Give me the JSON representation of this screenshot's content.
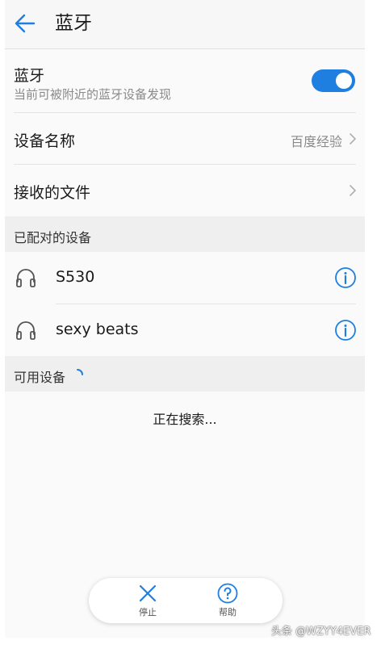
{
  "header": {
    "title": "蓝牙",
    "back_icon": "back-arrow-icon"
  },
  "bluetooth": {
    "title": "蓝牙",
    "subtitle": "当前可被附近的蓝牙设备发现",
    "enabled": true
  },
  "device_name_row": {
    "label": "设备名称",
    "value": "百度经验"
  },
  "received_files_row": {
    "label": "接收的文件"
  },
  "paired_section": {
    "label": "已配对的设备",
    "devices": [
      {
        "name": "S530",
        "icon": "headset-icon"
      },
      {
        "name": "sexy beats",
        "icon": "headset-icon"
      }
    ]
  },
  "available_section": {
    "label": "可用设备",
    "status": "正在搜索..."
  },
  "bottom_bar": {
    "stop_label": "停止",
    "help_label": "帮助"
  },
  "watermark": "头条 @WZYY4EVER",
  "colors": {
    "accent": "#1e7fe0",
    "section_bg": "#efefef",
    "divider": "#e3e3e3"
  }
}
